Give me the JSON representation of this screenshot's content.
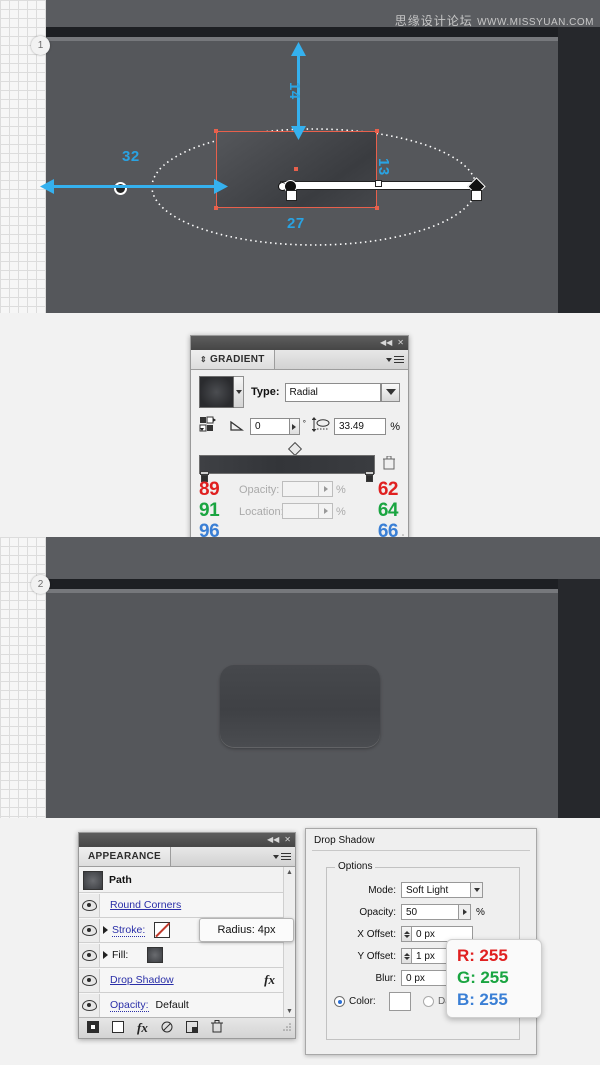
{
  "watermark": {
    "cn": "思缘设计论坛",
    "url": "WWW.MISSYUAN.COM"
  },
  "steps": {
    "one": "1",
    "two": "2"
  },
  "canvas1": {
    "dimensions": {
      "top": "14",
      "left": "32",
      "right": "13",
      "bottom": "27"
    }
  },
  "gradient_panel": {
    "titlebar": {
      "collapse_icon": "collapse-icon",
      "close_icon": "close-icon",
      "collapse_glyph": "◀◀",
      "close_glyph": "✕"
    },
    "tab_label": "GRADIENT",
    "tab_handle_glyph": "⇕",
    "type_label": "Type:",
    "type_value": "Radial",
    "angle_value": "0",
    "angle_unit": "°",
    "aspect_value": "33.49",
    "aspect_unit": "%",
    "opacity_label": "Opacity:",
    "opacity_value": "",
    "location_label": "Location:",
    "location_value": "",
    "percent": "%",
    "stop_left": {
      "r": "89",
      "g": "91",
      "b": "96"
    },
    "stop_right": {
      "r": "62",
      "g": "64",
      "b": "66"
    },
    "colors": {
      "red": "#e02020",
      "green": "#1aa541",
      "blue": "#3a7fd5"
    }
  },
  "appearance_panel": {
    "titlebar": {
      "collapse_glyph": "◀◀",
      "close_glyph": "✕"
    },
    "tab_label": "APPEARANCE",
    "rows": [
      {
        "name": "Path",
        "type": "header"
      },
      {
        "name": "Round Corners",
        "type": "effect"
      },
      {
        "name": "Stroke:",
        "type": "stroke"
      },
      {
        "name": "Fill:",
        "type": "fill"
      },
      {
        "name": "Drop Shadow",
        "type": "effect",
        "fx": "fx"
      },
      {
        "name": "Opacity:",
        "value": "Default",
        "type": "opacity"
      }
    ],
    "tooltip": "Radius: 4px",
    "footer_icons": [
      "add-new-stroke-icon",
      "add-new-fill-icon",
      "add-new-effect-icon",
      "clear-appearance-icon",
      "duplicate-item-icon",
      "delete-item-icon"
    ],
    "footer_fx": "fx"
  },
  "drop_shadow_dialog": {
    "title": "Drop Shadow",
    "options_legend": "Options",
    "fields": [
      {
        "label": "Mode:",
        "value": "Soft Light",
        "control": "dropdown"
      },
      {
        "label": "Opacity:",
        "value": "50",
        "unit": "%",
        "control": "stepper-arrow"
      },
      {
        "label": "X Offset:",
        "value": "0 px",
        "control": "spinner"
      },
      {
        "label": "Y Offset:",
        "value": "1 px",
        "control": "spinner"
      },
      {
        "label": "Blur:",
        "value": "0 px",
        "control": "stepper-arrow"
      }
    ],
    "color_label": "Color:",
    "darkness_label": "Darknes",
    "color_swatch": "#ffffff",
    "rgb_card": {
      "r_label": "R:",
      "r": "255",
      "g_label": "G:",
      "g": "255",
      "b_label": "B:",
      "b": "255"
    }
  }
}
